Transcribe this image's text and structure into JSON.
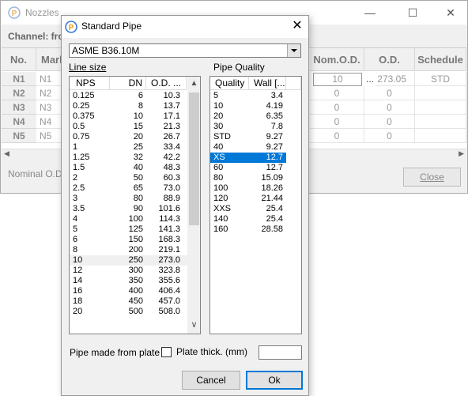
{
  "bg_window": {
    "title": "Nozzles",
    "channel_label": "Channel: fro",
    "columns": {
      "no": "No.",
      "mark": "Mark",
      "nom_od": "Nom.O.D.",
      "od": "O.D.",
      "schedule": "Schedule"
    },
    "rows": [
      {
        "no": "N1",
        "mark": "N1",
        "nom_od": "10",
        "od": "273.05",
        "schedule": "STD"
      },
      {
        "no": "N2",
        "mark": "N2",
        "nom_od": "0",
        "od": "0",
        "schedule": ""
      },
      {
        "no": "N3",
        "mark": "N3",
        "nom_od": "0",
        "od": "0",
        "schedule": ""
      },
      {
        "no": "N4",
        "mark": "N4",
        "nom_od": "0",
        "od": "0",
        "schedule": ""
      },
      {
        "no": "N5",
        "mark": "N5",
        "nom_od": "0",
        "od": "0",
        "schedule": ""
      }
    ],
    "ellipsis": "...",
    "footnote": "Nominal O.D. i",
    "close_button": "Close"
  },
  "dialog": {
    "title": "Standard Pipe",
    "standard": "ASME B36.10M",
    "line_size_label": "Line size",
    "pipe_quality_label": "Pipe Quality",
    "line_size_columns": {
      "nps": "NPS",
      "dn": "DN",
      "od": "O.D. ..."
    },
    "line_sizes": [
      {
        "nps": "0.125",
        "dn": "6",
        "od": "10.3"
      },
      {
        "nps": "0.25",
        "dn": "8",
        "od": "13.7"
      },
      {
        "nps": "0.375",
        "dn": "10",
        "od": "17.1"
      },
      {
        "nps": "0.5",
        "dn": "15",
        "od": "21.3"
      },
      {
        "nps": "0.75",
        "dn": "20",
        "od": "26.7"
      },
      {
        "nps": "1",
        "dn": "25",
        "od": "33.4"
      },
      {
        "nps": "1.25",
        "dn": "32",
        "od": "42.2"
      },
      {
        "nps": "1.5",
        "dn": "40",
        "od": "48.3"
      },
      {
        "nps": "2",
        "dn": "50",
        "od": "60.3"
      },
      {
        "nps": "2.5",
        "dn": "65",
        "od": "73.0"
      },
      {
        "nps": "3",
        "dn": "80",
        "od": "88.9"
      },
      {
        "nps": "3.5",
        "dn": "90",
        "od": "101.6"
      },
      {
        "nps": "4",
        "dn": "100",
        "od": "114.3"
      },
      {
        "nps": "5",
        "dn": "125",
        "od": "141.3"
      },
      {
        "nps": "6",
        "dn": "150",
        "od": "168.3"
      },
      {
        "nps": "8",
        "dn": "200",
        "od": "219.1"
      },
      {
        "nps": "10",
        "dn": "250",
        "od": "273.0"
      },
      {
        "nps": "12",
        "dn": "300",
        "od": "323.8"
      },
      {
        "nps": "14",
        "dn": "350",
        "od": "355.6"
      },
      {
        "nps": "16",
        "dn": "400",
        "od": "406.4"
      },
      {
        "nps": "18",
        "dn": "450",
        "od": "457.0"
      },
      {
        "nps": "20",
        "dn": "500",
        "od": "508.0"
      }
    ],
    "quality_columns": {
      "quality": "Quality",
      "wall": "Wall [..."
    },
    "qualities": [
      {
        "quality": "5",
        "wall": "3.4"
      },
      {
        "quality": "10",
        "wall": "4.19"
      },
      {
        "quality": "20",
        "wall": "6.35"
      },
      {
        "quality": "30",
        "wall": "7.8"
      },
      {
        "quality": "STD",
        "wall": "9.27"
      },
      {
        "quality": "40",
        "wall": "9.27"
      },
      {
        "quality": "XS",
        "wall": "12.7"
      },
      {
        "quality": "60",
        "wall": "12.7"
      },
      {
        "quality": "80",
        "wall": "15.09"
      },
      {
        "quality": "100",
        "wall": "18.26"
      },
      {
        "quality": "120",
        "wall": "21.44"
      },
      {
        "quality": "XXS",
        "wall": "25.4"
      },
      {
        "quality": "140",
        "wall": "25.4"
      },
      {
        "quality": "160",
        "wall": "28.58"
      }
    ],
    "selected_line_size": "10",
    "selected_quality": "XS",
    "plate_label": "Pipe made from plate",
    "plate_thick_label": "Plate thick. (mm)",
    "plate_thick_value": "",
    "cancel_button": "Cancel",
    "ok_button": "Ok"
  },
  "colors": {
    "selection": "#0078d7",
    "app_icon_ring": "#3a7bd5",
    "app_icon_fill": "#f39c12"
  }
}
